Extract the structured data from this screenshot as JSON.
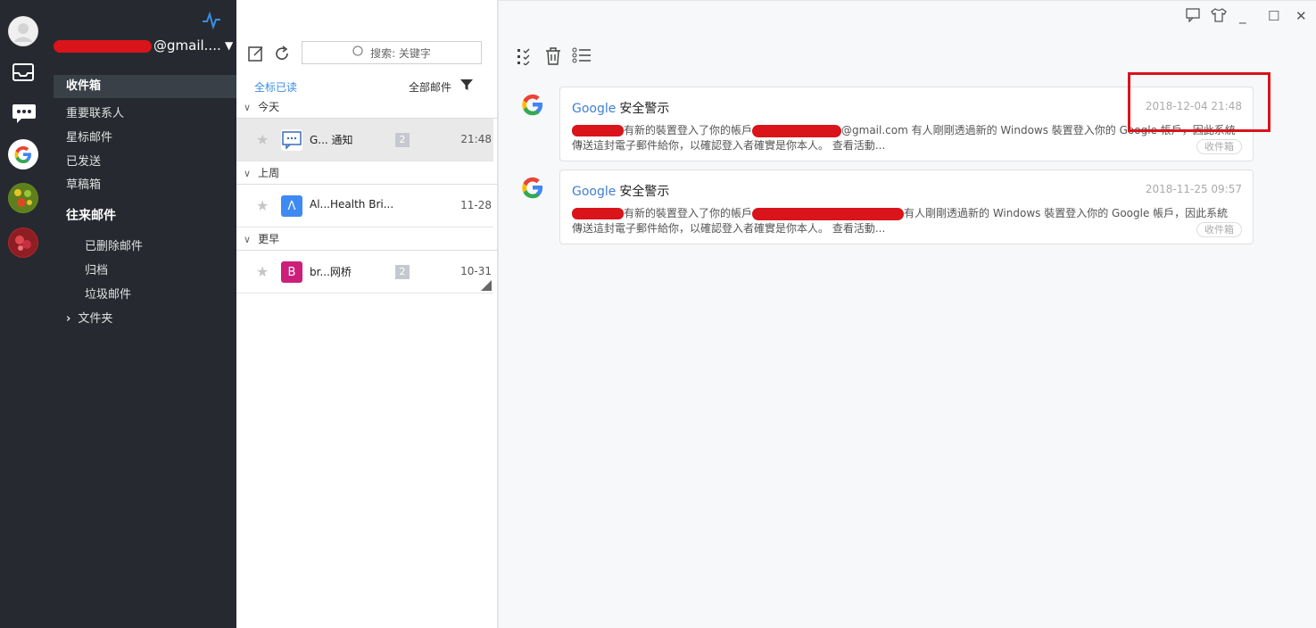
{
  "account": {
    "email_suffix": "@gmail...."
  },
  "folders": {
    "inbox": "收件箱",
    "vip": "重要联系人",
    "starred": "星标邮件",
    "sent": "已发送",
    "drafts": "草稿箱",
    "group": "往来邮件",
    "deleted": "已删除邮件",
    "archive": "归档",
    "junk": "垃圾邮件",
    "folders": "文件夹"
  },
  "list": {
    "search_placeholder": "搜索: 关键字",
    "mark_all_read": "全标已读",
    "all_mail": "全部邮件",
    "sections": [
      "今天",
      "上周",
      "更早"
    ],
    "rows": [
      {
        "subject": "G... 通知",
        "count": "2",
        "time": "21:48",
        "avatar": "…",
        "color": "#ffffff"
      },
      {
        "subject": "Al...Health Bri...",
        "count": "",
        "time": "11-28",
        "avatar": "Λ",
        "color": "#3f8af2"
      },
      {
        "subject": "br...网桥",
        "count": "2",
        "time": "10-31",
        "avatar": "B",
        "color": "#cc1f7a"
      }
    ]
  },
  "messages": [
    {
      "sender": "Google",
      "title": "安全警示",
      "date": "2018-12-04 21:48",
      "line1a": "有新的裝置登入了你的帳戶",
      "line1b": "@gmail.com 有人剛剛透過新的 Windows 裝置登入你的 Google 帳戶，因此系統",
      "line2": "傳送這封電子郵件給你，以確認登入者確實是你本人。 查看活動...",
      "folder": "收件箱"
    },
    {
      "sender": "Google",
      "title": "安全警示",
      "date": "2018-11-25 09:57",
      "line1a": "有新的裝置登入了你的帳戶",
      "line1b": "有人剛剛透過新的 Windows 裝置登入你的 Google 帳戶，因此系統",
      "line2": "傳送這封電子郵件給你，以確認登入者確實是你本人。 查看活動...",
      "folder": "收件箱"
    }
  ],
  "colors": {
    "sidebar": "#262a30",
    "accent": "#3a8ee6",
    "redaction": "#d9141a"
  }
}
